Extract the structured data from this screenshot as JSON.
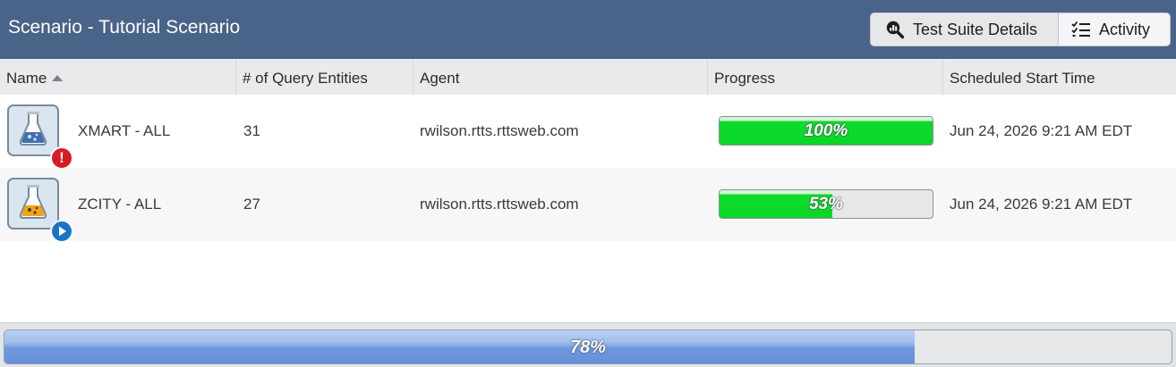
{
  "header": {
    "title": "Scenario - Tutorial Scenario",
    "buttons": {
      "details_label": "Test Suite Details",
      "activity_label": "Activity"
    }
  },
  "grid": {
    "columns": [
      "Name",
      "# of Query Entities",
      "Agent",
      "Progress",
      "Scheduled Start Time"
    ],
    "rows": [
      {
        "name": "XMART - ALL",
        "entities": "31",
        "agent": "rwilson.rtts.rttsweb.com",
        "progress": 100,
        "progress_label": "100%",
        "start_time": "Jun 24, 2026 9:21 AM EDT",
        "status": "error-icon"
      },
      {
        "name": "ZCITY - ALL",
        "entities": "27",
        "agent": "rwilson.rtts.rttsweb.com",
        "progress": 53,
        "progress_label": "53%",
        "start_time": "Jun 24, 2026 9:21 AM EDT",
        "status": "running-icon"
      }
    ]
  },
  "footer": {
    "progress": 78,
    "progress_label": "78%"
  },
  "colors": {
    "header_bg": "#4a6389",
    "progress_green": "#0edb2c",
    "progress_blue": "#6690d8",
    "error_red": "#d41c27",
    "running_blue": "#1875c5"
  }
}
